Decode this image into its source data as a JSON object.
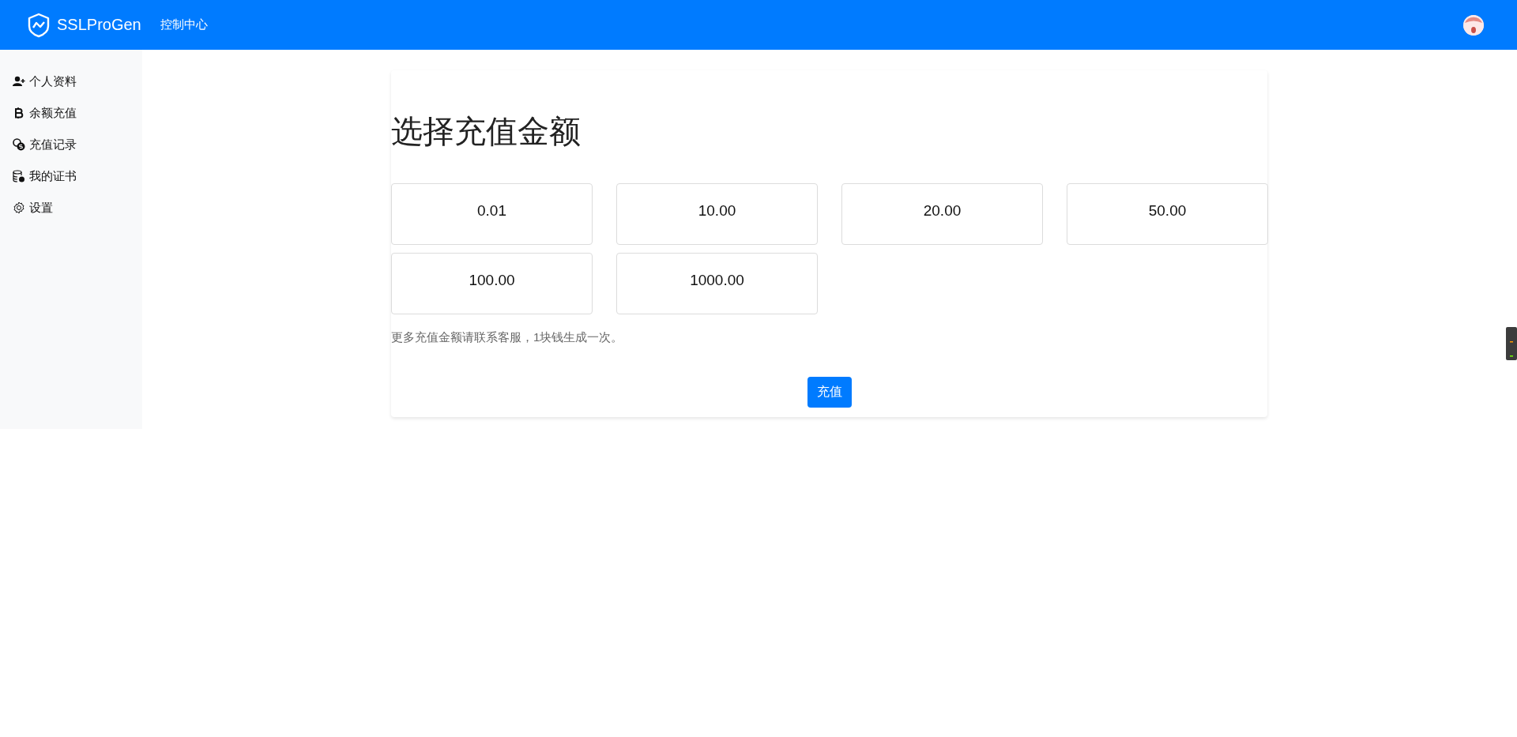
{
  "header": {
    "brand": "SSLProGen",
    "nav": [
      "控制中心"
    ]
  },
  "sidebar": {
    "items": [
      {
        "label": "个人资料"
      },
      {
        "label": "余额充值"
      },
      {
        "label": "充值记录"
      },
      {
        "label": "我的证书"
      },
      {
        "label": "设置"
      }
    ]
  },
  "recharge": {
    "title": "选择充值金额",
    "amounts": [
      "0.01",
      "10.00",
      "20.00",
      "50.00",
      "100.00",
      "1000.00"
    ],
    "note": "更多充值金额请联系客服，1块钱生成一次。",
    "submit": "充值"
  }
}
